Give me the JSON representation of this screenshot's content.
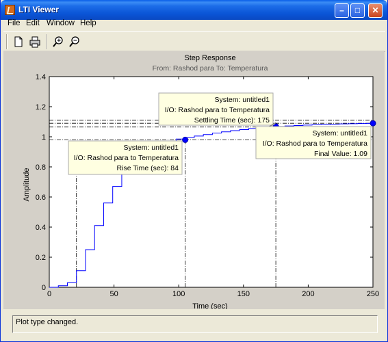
{
  "window": {
    "title": "LTI Viewer"
  },
  "menu": [
    "File",
    "Edit",
    "Window",
    "Help"
  ],
  "toolbar_icons": [
    "new-document-icon",
    "print-icon",
    "zoom-in-icon",
    "zoom-out-icon"
  ],
  "plot": {
    "title": "Step Response",
    "subtitle": "From: Rashod para  To: Temperatura",
    "xlabel": "Time (sec)",
    "ylabel": "Amplitude"
  },
  "chart_data": {
    "type": "line",
    "title": "Step Response",
    "subtitle": "From: Rashod para  To: Temperatura",
    "xlabel": "Time (sec)",
    "ylabel": "Amplitude",
    "xlim": [
      0,
      250
    ],
    "ylim": [
      0,
      1.4
    ],
    "xticks": [
      0,
      50,
      100,
      150,
      200,
      250
    ],
    "yticks": [
      0,
      0.2,
      0.4,
      0.6,
      0.8,
      1,
      1.2,
      1.4
    ],
    "grid": false,
    "series": [
      {
        "step": true,
        "x": [
          0,
          7,
          14,
          21,
          28,
          35,
          42,
          49,
          56,
          63,
          70,
          77,
          84,
          91,
          98,
          105,
          112,
          119,
          126,
          133,
          140,
          147,
          154,
          161,
          168,
          175,
          182,
          189,
          196,
          203,
          210,
          217,
          224,
          231,
          238,
          245,
          250
        ],
        "y": [
          0,
          0.01,
          0.03,
          0.11,
          0.25,
          0.41,
          0.56,
          0.67,
          0.75,
          0.82,
          0.87,
          0.92,
          0.95,
          0.97,
          0.985,
          0.995,
          1.005,
          1.015,
          1.025,
          1.033,
          1.041,
          1.048,
          1.055,
          1.06,
          1.065,
          1.069,
          1.072,
          1.075,
          1.078,
          1.08,
          1.082,
          1.084,
          1.086,
          1.087,
          1.088,
          1.089,
          1.09
        ]
      }
    ],
    "reference_lines": [
      0.98,
      1.065,
      1.09,
      1.11
    ],
    "markers": [
      {
        "x": 105,
        "y": 0.98
      },
      {
        "x": 175,
        "y": 1.069
      },
      {
        "x": 250,
        "y": 1.09
      }
    ],
    "annotations": [
      {
        "lines": [
          "System: untitled1",
          "I/O: Rashod para to Temperatura",
          "Rise Time (sec): 84"
        ]
      },
      {
        "lines": [
          "System: untitled1",
          "I/O: Rashod para to Temperatura",
          "Settling Time (sec): 175"
        ]
      },
      {
        "lines": [
          "System: untitled1",
          "I/O: Rashod para to Temperatura",
          "Final Value: 1.09"
        ]
      }
    ]
  },
  "status": "Plot type changed."
}
